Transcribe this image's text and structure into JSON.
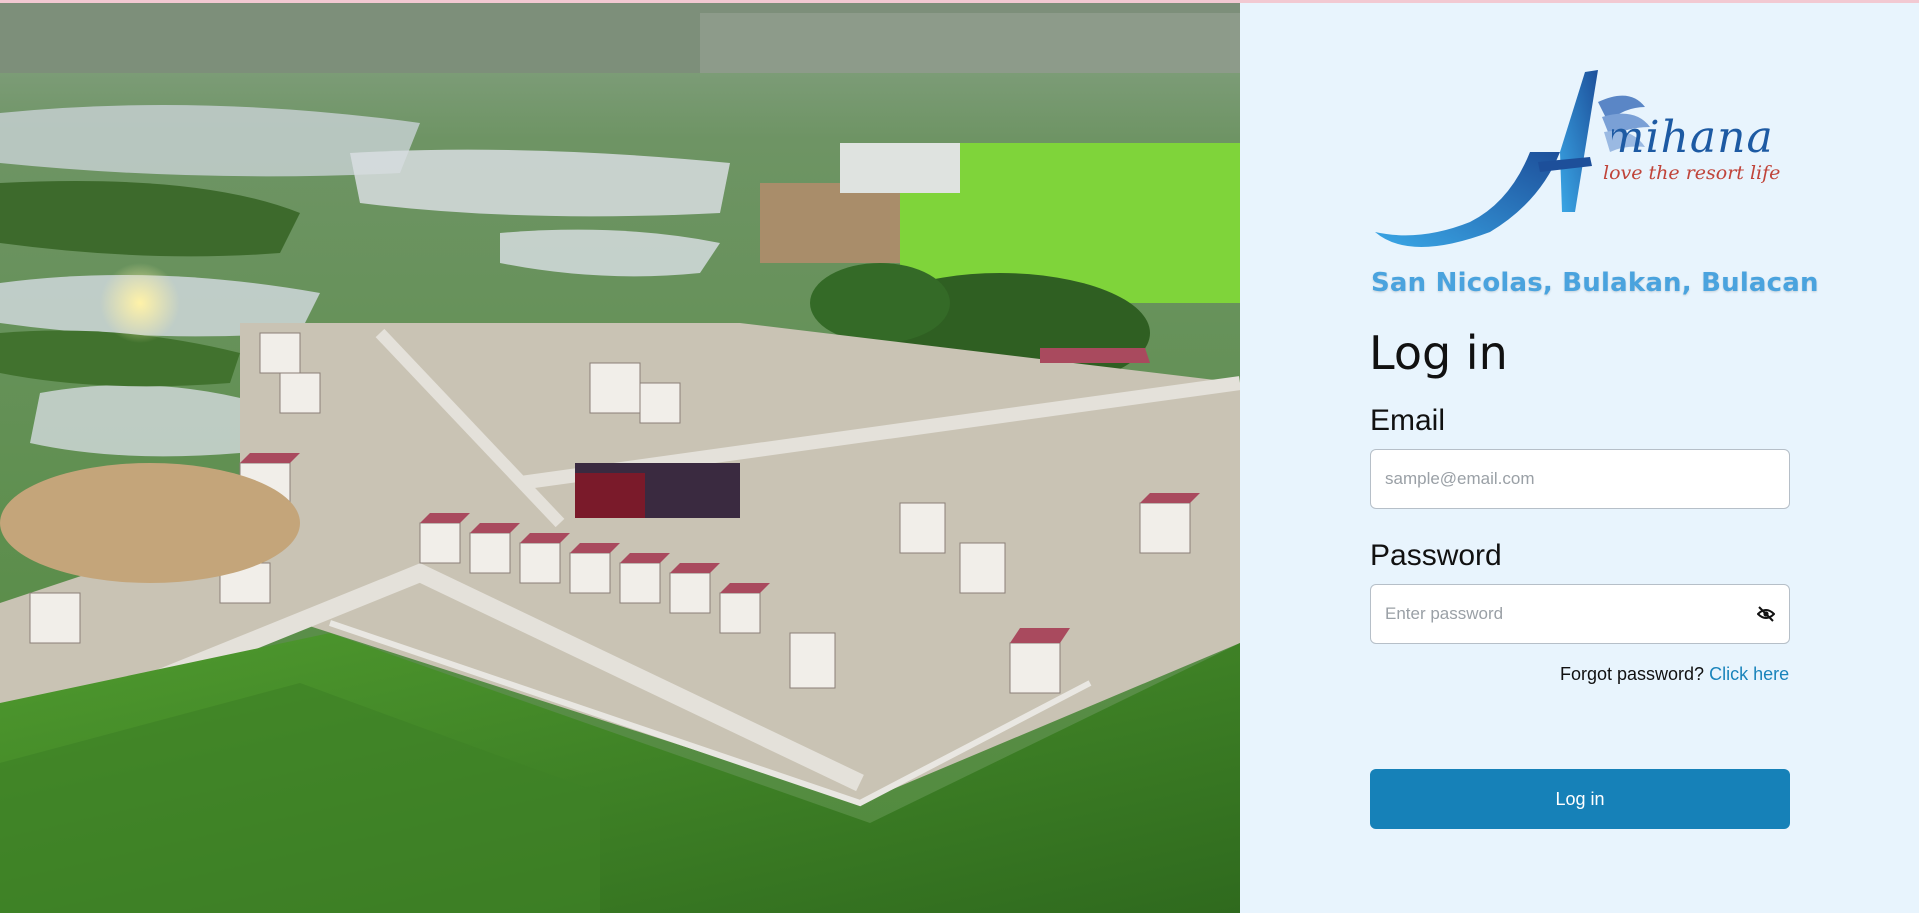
{
  "brand": {
    "logo_text": "Amihana",
    "tagline": "love the resort life",
    "location": "San Nicolas, Bulakan, Bulacan",
    "primary_color": "#1681b8",
    "panel_bg": "#e8f4fd"
  },
  "hero": {
    "description_icon": "aerial-village-photo"
  },
  "form": {
    "heading": "Log in",
    "email": {
      "label": "Email",
      "value": "",
      "placeholder": "sample@email.com"
    },
    "password": {
      "label": "Password",
      "value": "",
      "placeholder": "Enter password",
      "toggle_icon": "eye-slash-icon"
    },
    "forgot": {
      "prompt": "Forgot password?",
      "link": "Click here"
    },
    "submit_label": "Log in"
  }
}
